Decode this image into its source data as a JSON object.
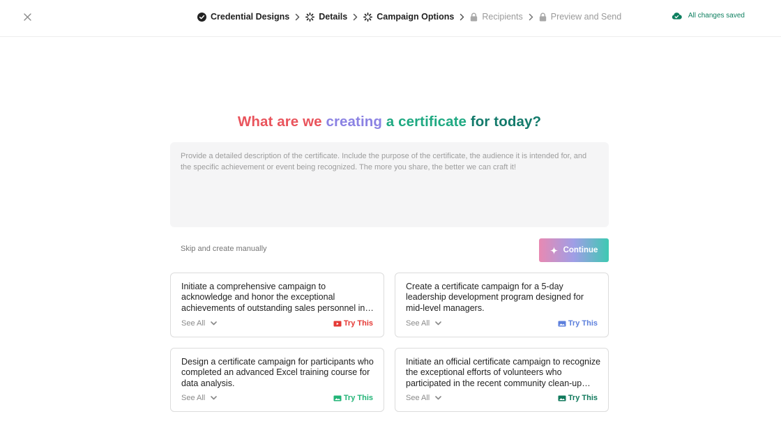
{
  "header": {
    "steps": [
      {
        "label": "Credential Designs",
        "state": "done"
      },
      {
        "label": "Details",
        "state": "active"
      },
      {
        "label": "Campaign Options",
        "state": "active"
      },
      {
        "label": "Recipients",
        "state": "locked"
      },
      {
        "label": "Preview and Send",
        "state": "locked"
      }
    ],
    "saved_status": "All changes saved"
  },
  "main": {
    "headline_parts": [
      "What are we",
      "creating",
      "a certificate",
      "for today?"
    ],
    "prompt": {
      "value": "",
      "placeholder": "Provide a detailed description of the certificate. Include the purpose of the certificate, the audience it is intended for, and the specific achievement or event being recognized. The more you share, the better we can craft it!"
    },
    "skip_label": "Skip and create manually",
    "continue_label": "Continue"
  },
  "suggestions": [
    {
      "text": "Initiate a comprehensive campaign to acknowledge and honor the exceptional achievements of outstanding sales personnel in the organization.",
      "see_all": "See All",
      "try_label": "Try This",
      "color": "#e53935"
    },
    {
      "text": "Create a certificate campaign for a 5-day leadership development program designed for mid-level managers.",
      "see_all": "See All",
      "try_label": "Try This",
      "color": "#5c7fdc"
    },
    {
      "text": "Design a certificate campaign for participants who completed an advanced Excel training course for data analysis.",
      "see_all": "See All",
      "try_label": "Try This",
      "color": "#22b477"
    },
    {
      "text": "Initiate an official certificate campaign to recognize the exceptional efforts of volunteers who participated in the recent community clean-up drive.",
      "see_all": "See All",
      "try_label": "Try This",
      "color": "#11795c"
    }
  ],
  "colors": {
    "saved": "#0d7f5f",
    "headline": [
      "#e9545c",
      "#8b82e3",
      "#1fa982",
      "#137a6b"
    ]
  }
}
